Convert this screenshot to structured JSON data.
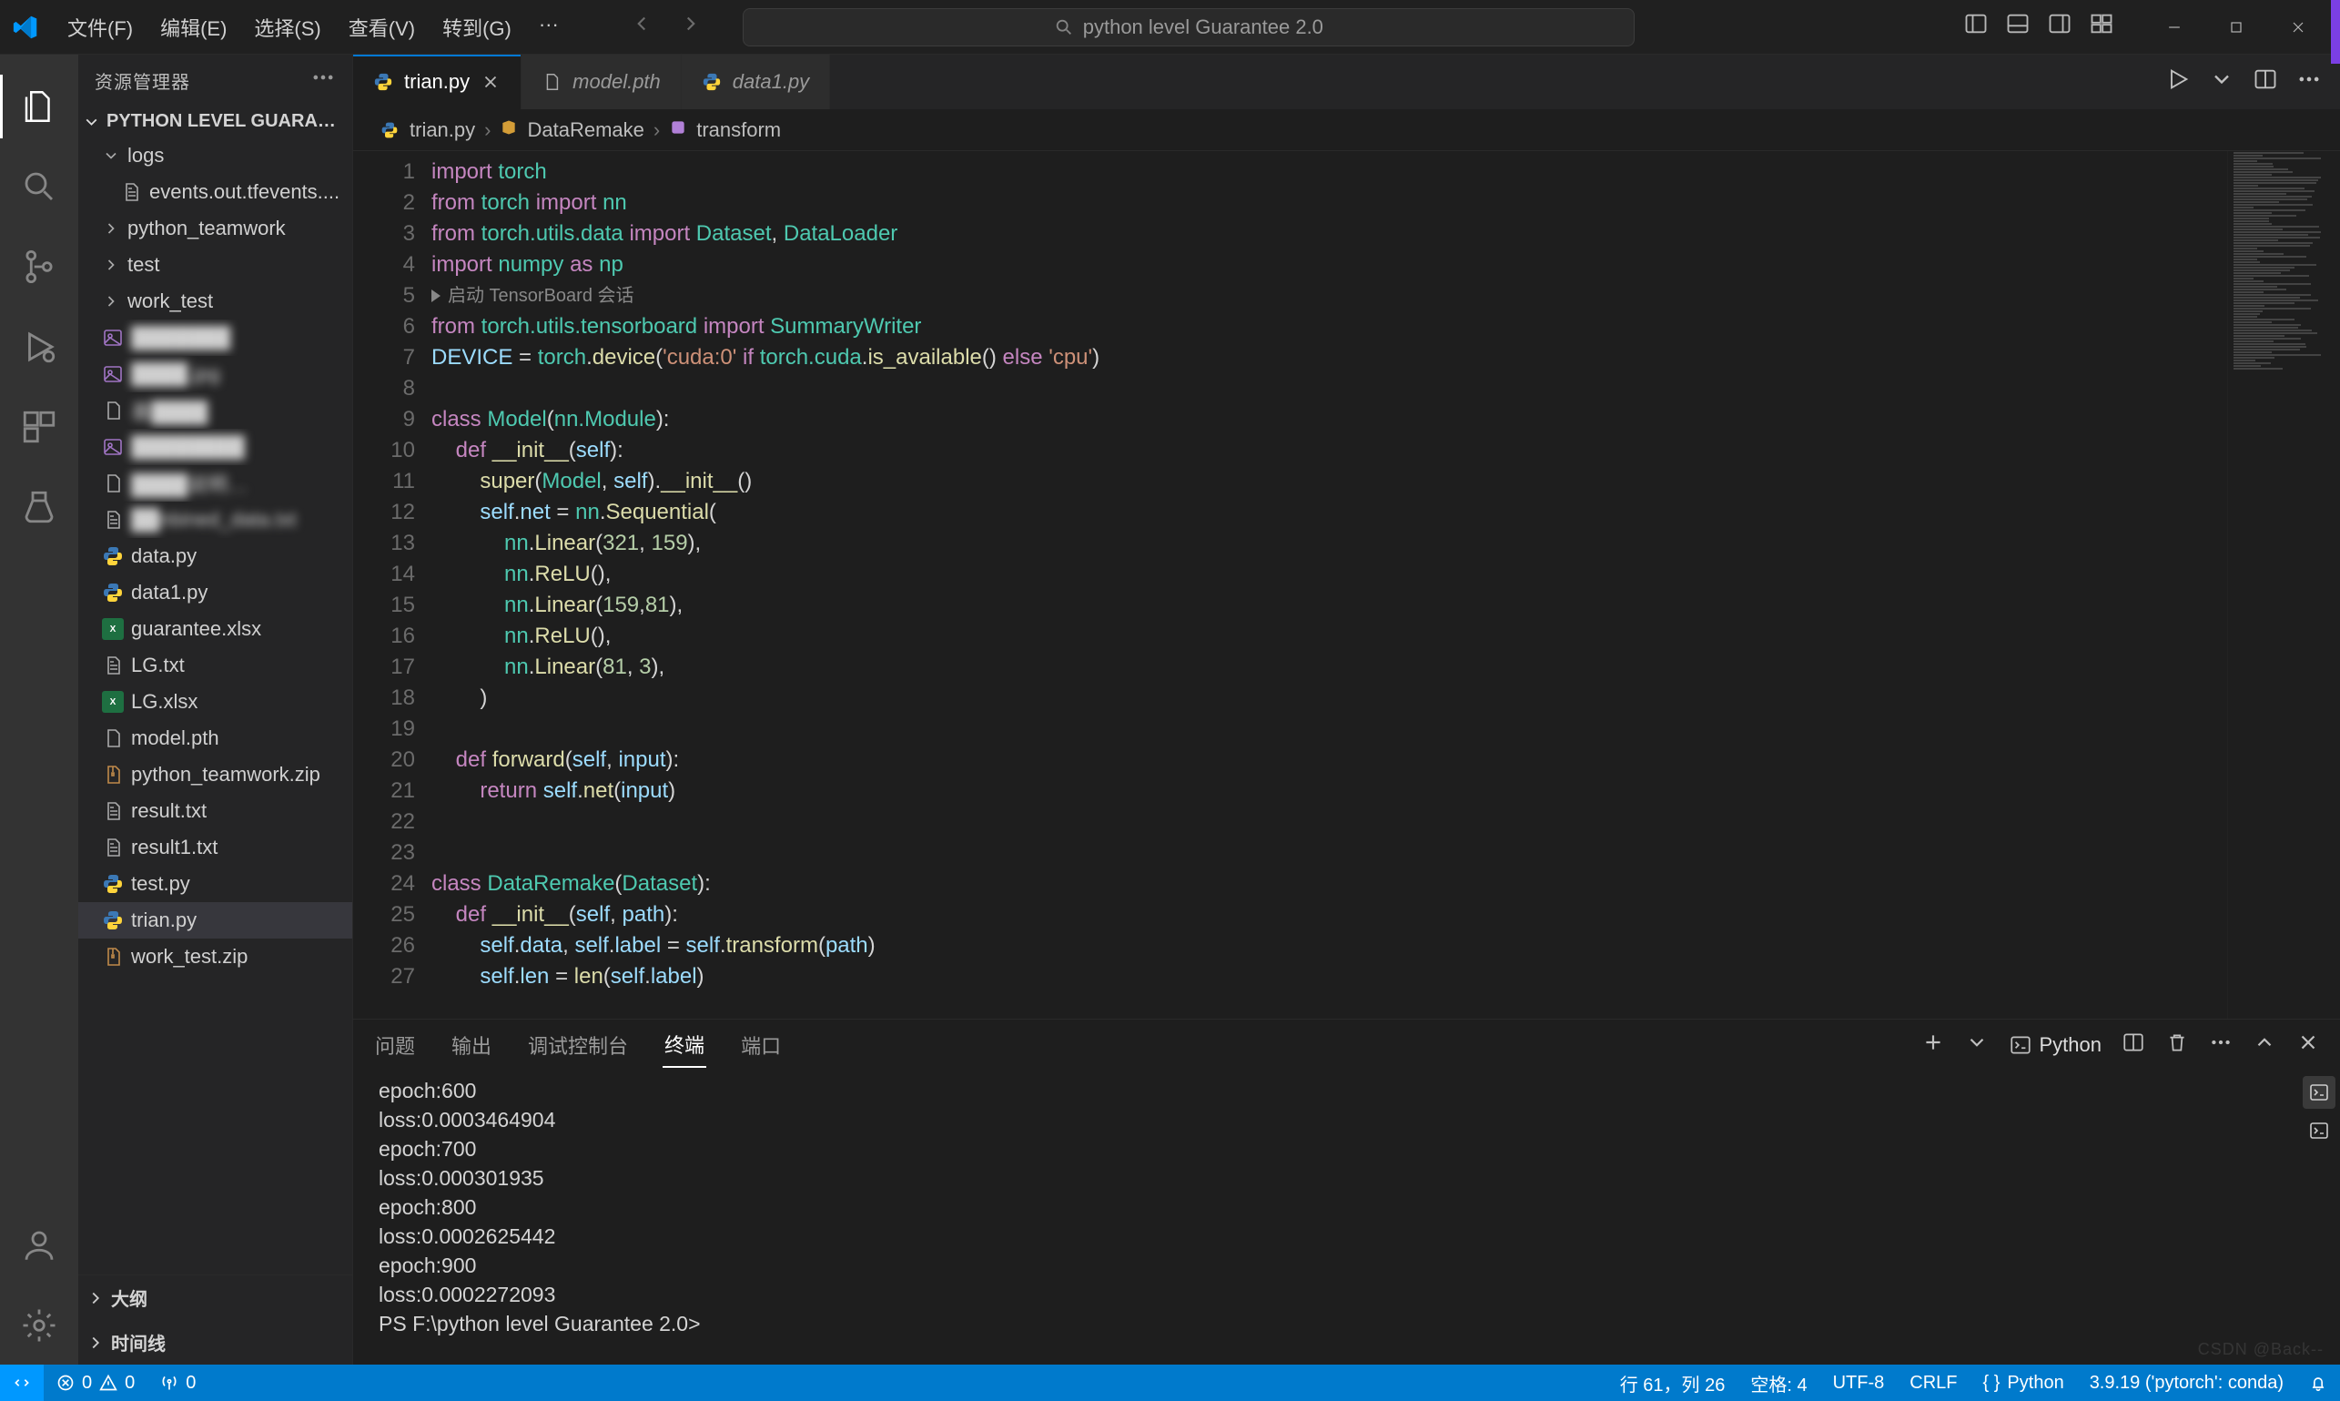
{
  "titlebar": {
    "menus": [
      "文件(F)",
      "编辑(E)",
      "选择(S)",
      "查看(V)",
      "转到(G)",
      "···"
    ],
    "search_placeholder": "python level Guarantee 2.0"
  },
  "activitybar": {
    "items": [
      {
        "name": "explorer-icon",
        "active": true
      },
      {
        "name": "search-icon",
        "active": false
      },
      {
        "name": "source-control-icon",
        "active": false
      },
      {
        "name": "run-debug-icon",
        "active": false
      },
      {
        "name": "extensions-icon",
        "active": false
      },
      {
        "name": "beaker-icon",
        "active": false
      }
    ],
    "bottom": [
      {
        "name": "account-icon"
      },
      {
        "name": "settings-gear-icon"
      }
    ]
  },
  "sidebar": {
    "title": "资源管理器",
    "root": "PYTHON LEVEL GUARANT…",
    "tree": [
      {
        "kind": "folder",
        "label": "logs",
        "expanded": true,
        "depth": 0
      },
      {
        "kind": "file",
        "label": "events.out.tfevents....",
        "icon": "txt",
        "depth": 1
      },
      {
        "kind": "folder",
        "label": "python_teamwork",
        "expanded": false,
        "depth": 0
      },
      {
        "kind": "folder",
        "label": "test",
        "expanded": false,
        "depth": 0
      },
      {
        "kind": "folder",
        "label": "work_test",
        "expanded": false,
        "depth": 0
      },
      {
        "kind": "file",
        "label": "███████",
        "icon": "img",
        "depth": 0,
        "blur": true
      },
      {
        "kind": "file",
        "label": "████.jpg",
        "icon": "img",
        "depth": 0,
        "blur": true
      },
      {
        "kind": "file",
        "label": "基████",
        "icon": "bin",
        "depth": 0,
        "blur": true
      },
      {
        "kind": "file",
        "label": "████████",
        "icon": "img",
        "depth": 0,
        "blur": true
      },
      {
        "kind": "file",
        "label": "████说明…",
        "icon": "bin",
        "depth": 0,
        "blur": true
      },
      {
        "kind": "file",
        "label": "██nbined_data.txt",
        "icon": "txt",
        "depth": 0,
        "blur": true
      },
      {
        "kind": "file",
        "label": "data.py",
        "icon": "py",
        "depth": 0
      },
      {
        "kind": "file",
        "label": "data1.py",
        "icon": "py",
        "depth": 0
      },
      {
        "kind": "file",
        "label": "guarantee.xlsx",
        "icon": "xls",
        "depth": 0
      },
      {
        "kind": "file",
        "label": "LG.txt",
        "icon": "txt",
        "depth": 0
      },
      {
        "kind": "file",
        "label": "LG.xlsx",
        "icon": "xls",
        "depth": 0
      },
      {
        "kind": "file",
        "label": "model.pth",
        "icon": "bin",
        "depth": 0
      },
      {
        "kind": "file",
        "label": "python_teamwork.zip",
        "icon": "zip",
        "depth": 0
      },
      {
        "kind": "file",
        "label": "result.txt",
        "icon": "txt",
        "depth": 0
      },
      {
        "kind": "file",
        "label": "result1.txt",
        "icon": "txt",
        "depth": 0
      },
      {
        "kind": "file",
        "label": "test.py",
        "icon": "py",
        "depth": 0
      },
      {
        "kind": "file",
        "label": "trian.py",
        "icon": "py",
        "depth": 0,
        "selected": true
      },
      {
        "kind": "file",
        "label": "work_test.zip",
        "icon": "zip",
        "depth": 0
      }
    ],
    "bottom_sections": [
      "大纲",
      "时间线"
    ]
  },
  "tabs": [
    {
      "label": "trian.py",
      "icon": "py",
      "active": true,
      "closeable": true
    },
    {
      "label": "model.pth",
      "icon": "bin",
      "active": false,
      "italic": true
    },
    {
      "label": "data1.py",
      "icon": "py",
      "active": false,
      "italic": true
    }
  ],
  "breadcrumb": [
    {
      "icon": "py",
      "label": "trian.py"
    },
    {
      "icon": "class",
      "label": "DataRemake"
    },
    {
      "icon": "method",
      "label": "transform"
    }
  ],
  "code": {
    "codelens": "启动 TensorBoard 会话",
    "lines": [
      [
        [
          "k",
          "import"
        ],
        [
          "w",
          " "
        ],
        [
          "m",
          "torch"
        ]
      ],
      [
        [
          "k",
          "from"
        ],
        [
          "w",
          " "
        ],
        [
          "m",
          "torch"
        ],
        [
          "w",
          " "
        ],
        [
          "k",
          "import"
        ],
        [
          "w",
          " "
        ],
        [
          "m",
          "nn"
        ]
      ],
      [
        [
          "k",
          "from"
        ],
        [
          "w",
          " "
        ],
        [
          "m",
          "torch.utils.data"
        ],
        [
          "w",
          " "
        ],
        [
          "k",
          "import"
        ],
        [
          "w",
          " "
        ],
        [
          "m",
          "Dataset"
        ],
        [
          "o",
          ", "
        ],
        [
          "m",
          "DataLoader"
        ]
      ],
      [
        [
          "k",
          "import"
        ],
        [
          "w",
          " "
        ],
        [
          "m",
          "numpy"
        ],
        [
          "w",
          " "
        ],
        [
          "k",
          "as"
        ],
        [
          "w",
          " "
        ],
        [
          "m",
          "np"
        ]
      ],
      null,
      [
        [
          "k",
          "from"
        ],
        [
          "w",
          " "
        ],
        [
          "m",
          "torch.utils.tensorboard"
        ],
        [
          "w",
          " "
        ],
        [
          "k",
          "import"
        ],
        [
          "w",
          " "
        ],
        [
          "m",
          "SummaryWriter"
        ]
      ],
      [
        [
          "v",
          "DEVICE"
        ],
        [
          "o",
          " = "
        ],
        [
          "m",
          "torch"
        ],
        [
          "o",
          "."
        ],
        [
          "f",
          "device"
        ],
        [
          "o",
          "("
        ],
        [
          "s",
          "'cuda:0'"
        ],
        [
          "w",
          " "
        ],
        [
          "k",
          "if"
        ],
        [
          "w",
          " "
        ],
        [
          "m",
          "torch.cuda"
        ],
        [
          "o",
          "."
        ],
        [
          "f",
          "is_available"
        ],
        [
          "o",
          "() "
        ],
        [
          "k",
          "else"
        ],
        [
          "w",
          " "
        ],
        [
          "s",
          "'cpu'"
        ],
        [
          "o",
          ")"
        ]
      ],
      [],
      [
        [
          "k",
          "class"
        ],
        [
          "w",
          " "
        ],
        [
          "m",
          "Model"
        ],
        [
          "o",
          "("
        ],
        [
          "m",
          "nn.Module"
        ],
        [
          "o",
          "):"
        ]
      ],
      [
        [
          "w",
          "    "
        ],
        [
          "k",
          "def"
        ],
        [
          "w",
          " "
        ],
        [
          "f",
          "__init__"
        ],
        [
          "o",
          "("
        ],
        [
          "v",
          "self"
        ],
        [
          "o",
          "):"
        ]
      ],
      [
        [
          "w",
          "        "
        ],
        [
          "f",
          "super"
        ],
        [
          "o",
          "("
        ],
        [
          "m",
          "Model"
        ],
        [
          "o",
          ", "
        ],
        [
          "v",
          "self"
        ],
        [
          "o",
          ")."
        ],
        [
          "f",
          "__init__"
        ],
        [
          "o",
          "()"
        ]
      ],
      [
        [
          "w",
          "        "
        ],
        [
          "v",
          "self"
        ],
        [
          "o",
          "."
        ],
        [
          "v",
          "net"
        ],
        [
          "o",
          " = "
        ],
        [
          "m",
          "nn"
        ],
        [
          "o",
          "."
        ],
        [
          "f",
          "Sequential"
        ],
        [
          "o",
          "("
        ]
      ],
      [
        [
          "w",
          "            "
        ],
        [
          "m",
          "nn"
        ],
        [
          "o",
          "."
        ],
        [
          "f",
          "Linear"
        ],
        [
          "o",
          "("
        ],
        [
          "n",
          "321"
        ],
        [
          "o",
          ", "
        ],
        [
          "n",
          "159"
        ],
        [
          "o",
          "),"
        ]
      ],
      [
        [
          "w",
          "            "
        ],
        [
          "m",
          "nn"
        ],
        [
          "o",
          "."
        ],
        [
          "f",
          "ReLU"
        ],
        [
          "o",
          "(),"
        ]
      ],
      [
        [
          "w",
          "            "
        ],
        [
          "m",
          "nn"
        ],
        [
          "o",
          "."
        ],
        [
          "f",
          "Linear"
        ],
        [
          "o",
          "("
        ],
        [
          "n",
          "159"
        ],
        [
          "o",
          ","
        ],
        [
          "n",
          "81"
        ],
        [
          "o",
          "),"
        ]
      ],
      [
        [
          "w",
          "            "
        ],
        [
          "m",
          "nn"
        ],
        [
          "o",
          "."
        ],
        [
          "f",
          "ReLU"
        ],
        [
          "o",
          "(),"
        ]
      ],
      [
        [
          "w",
          "            "
        ],
        [
          "m",
          "nn"
        ],
        [
          "o",
          "."
        ],
        [
          "f",
          "Linear"
        ],
        [
          "o",
          "("
        ],
        [
          "n",
          "81"
        ],
        [
          "o",
          ", "
        ],
        [
          "n",
          "3"
        ],
        [
          "o",
          "),"
        ]
      ],
      [
        [
          "w",
          "        "
        ],
        [
          "o",
          ")"
        ]
      ],
      [],
      [
        [
          "w",
          "    "
        ],
        [
          "k",
          "def"
        ],
        [
          "w",
          " "
        ],
        [
          "f",
          "forward"
        ],
        [
          "o",
          "("
        ],
        [
          "v",
          "self"
        ],
        [
          "o",
          ", "
        ],
        [
          "v",
          "input"
        ],
        [
          "o",
          "):"
        ]
      ],
      [
        [
          "w",
          "        "
        ],
        [
          "k",
          "return"
        ],
        [
          "w",
          " "
        ],
        [
          "v",
          "self"
        ],
        [
          "o",
          "."
        ],
        [
          "f",
          "net"
        ],
        [
          "o",
          "("
        ],
        [
          "v",
          "input"
        ],
        [
          "o",
          ")"
        ]
      ],
      [],
      [],
      [
        [
          "k",
          "class"
        ],
        [
          "w",
          " "
        ],
        [
          "m",
          "DataRemake"
        ],
        [
          "o",
          "("
        ],
        [
          "m",
          "Dataset"
        ],
        [
          "o",
          "):"
        ]
      ],
      [
        [
          "w",
          "    "
        ],
        [
          "k",
          "def"
        ],
        [
          "w",
          " "
        ],
        [
          "f",
          "__init__"
        ],
        [
          "o",
          "("
        ],
        [
          "v",
          "self"
        ],
        [
          "o",
          ", "
        ],
        [
          "v",
          "path"
        ],
        [
          "o",
          "):"
        ]
      ],
      [
        [
          "w",
          "        "
        ],
        [
          "v",
          "self"
        ],
        [
          "o",
          "."
        ],
        [
          "v",
          "data"
        ],
        [
          "o",
          ", "
        ],
        [
          "v",
          "self"
        ],
        [
          "o",
          "."
        ],
        [
          "v",
          "label"
        ],
        [
          "o",
          " = "
        ],
        [
          "v",
          "self"
        ],
        [
          "o",
          "."
        ],
        [
          "f",
          "transform"
        ],
        [
          "o",
          "("
        ],
        [
          "v",
          "path"
        ],
        [
          "o",
          ")"
        ]
      ],
      [
        [
          "w",
          "        "
        ],
        [
          "v",
          "self"
        ],
        [
          "o",
          "."
        ],
        [
          "v",
          "len"
        ],
        [
          "o",
          " = "
        ],
        [
          "f",
          "len"
        ],
        [
          "o",
          "("
        ],
        [
          "v",
          "self"
        ],
        [
          "o",
          "."
        ],
        [
          "v",
          "label"
        ],
        [
          "o",
          ")"
        ]
      ],
      []
    ]
  },
  "panel": {
    "tabs": [
      "问题",
      "输出",
      "调试控制台",
      "终端",
      "端口"
    ],
    "active_tab": "终端",
    "term_label": "Python",
    "lines": [
      "epoch:600",
      " loss:0.0003464904",
      "epoch:700",
      " loss:0.000301935",
      "epoch:800",
      " loss:0.0002625442",
      "epoch:900",
      " loss:0.0002272093",
      "PS F:\\python level Guarantee 2.0>"
    ]
  },
  "statusbar": {
    "errors": "0",
    "warnings": "0",
    "ports": "0",
    "ln_col": "行 61，列 26",
    "indent": "空格: 4",
    "encoding": "UTF-8",
    "eol": "CRLF",
    "lang": "Python",
    "interpreter": "3.9.19 ('pytorch': conda)"
  },
  "watermark": "CSDN @Back--"
}
